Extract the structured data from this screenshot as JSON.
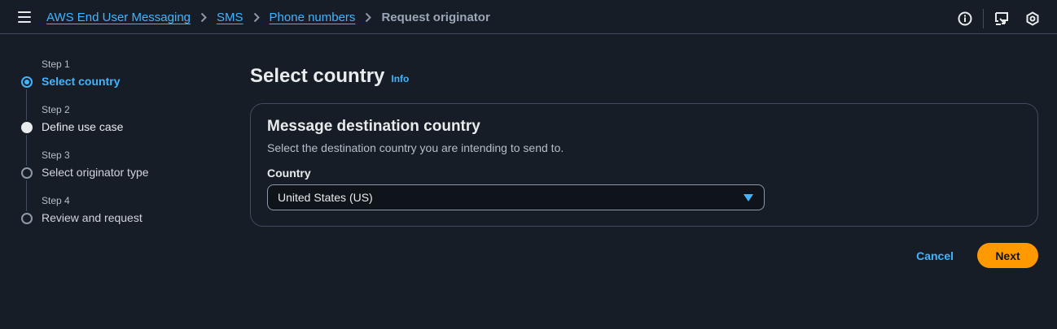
{
  "breadcrumb": {
    "items": [
      "AWS End User Messaging",
      "SMS",
      "Phone numbers"
    ],
    "current": "Request originator"
  },
  "steps": [
    {
      "number": "Step 1",
      "label": "Select country",
      "state": "active"
    },
    {
      "number": "Step 2",
      "label": "Define use case",
      "state": "visited"
    },
    {
      "number": "Step 3",
      "label": "Select originator type",
      "state": "pending"
    },
    {
      "number": "Step 4",
      "label": "Review and request",
      "state": "pending"
    }
  ],
  "page": {
    "title": "Select country",
    "info_label": "Info"
  },
  "card": {
    "title": "Message destination country",
    "description": "Select the destination country you are intending to send to.",
    "field_label": "Country",
    "selected_value": "United States (US)"
  },
  "actions": {
    "cancel_label": "Cancel",
    "next_label": "Next"
  },
  "colors": {
    "background": "#161d26",
    "link": "#42b4ff",
    "primary_button": "#ff9900",
    "border": "#414d5c"
  },
  "icons": [
    "menu-icon",
    "chevron-right-icon",
    "info-icon",
    "feedback-icon",
    "settings-icon",
    "caret-down-icon"
  ]
}
